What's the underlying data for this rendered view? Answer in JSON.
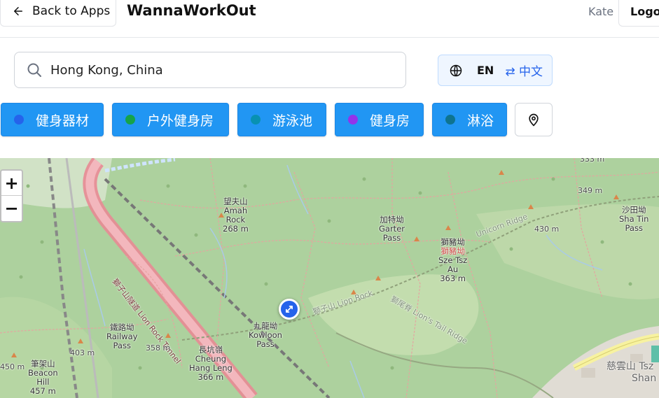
{
  "header": {
    "back_label": "Back to Apps",
    "app_title": "WannaWorkOut",
    "user_name": "Kate",
    "logout_label": "Logout"
  },
  "search": {
    "value": "Hong Kong, China"
  },
  "language": {
    "current": "EN",
    "toggle_label": "⇄ 中文"
  },
  "filters": [
    {
      "label": "健身器材",
      "dot_color": "#2563eb"
    },
    {
      "label": "户外健身房",
      "dot_color": "#16a34a"
    },
    {
      "label": "游泳池",
      "dot_color": "#0891b2"
    },
    {
      "label": "健身房",
      "dot_color": "#9333ea"
    },
    {
      "label": "淋浴",
      "dot_color": "#0e7490"
    }
  ],
  "map": {
    "zoom_in": "+",
    "zoom_out": "−",
    "labels": {
      "amah_rock": [
        "望夫山",
        "Amah",
        "Rock",
        "268 m"
      ],
      "garter_pass": [
        "加特坳",
        "Garter",
        "Pass"
      ],
      "sze_tsz_au": [
        "獅豬坳",
        "獅豬坳",
        "Sze Tsz",
        "Au",
        "363 m"
      ],
      "sha_tin_pass": [
        "沙田坳",
        "Sha Tin",
        "Pass"
      ],
      "kowloon_pass": [
        "九龍坳",
        "Kowloon",
        "Pass"
      ],
      "railway_pass": [
        "鐵路坳",
        "Railway",
        "Pass"
      ],
      "cheung_hang_leng": [
        "長坑嶺",
        "Cheung",
        "Hang Leng",
        "366 m"
      ],
      "beacon_hill": [
        "筆架山",
        "Beacon",
        "Hill",
        "457 m"
      ],
      "lion_rock_tunnel": "獅子山隧道 Lion Rock Tunnel",
      "lion_rock": "獅子山 Lion Rock",
      "lions_tail_ridge": "獅尾脊 Lion's Tail Ridge",
      "unicorn_ridge": "Unicorn Ridge",
      "tsz_wan_shan": [
        "慈雲山 Tsz",
        "Shan"
      ],
      "elev_349": "349 m",
      "elev_430": "430 m",
      "elev_358": "358 m",
      "elev_403": "403 m",
      "elev_450": "450 m",
      "elev_333": "333 m"
    }
  }
}
